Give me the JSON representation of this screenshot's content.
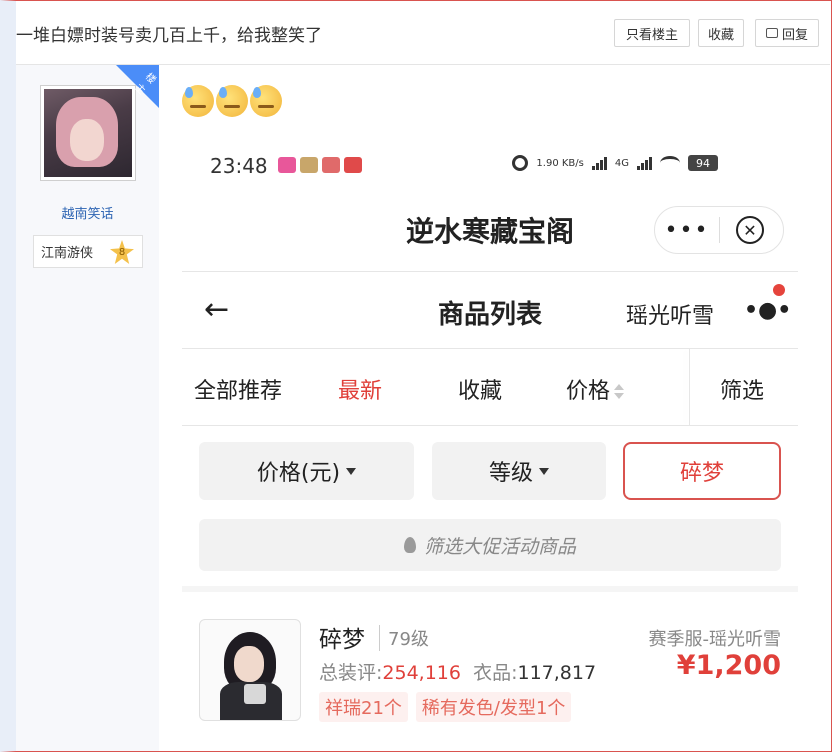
{
  "post": {
    "title": "一堆白嫖时装号卖几百上千，给我整笑了",
    "buttons": {
      "only_op": "只看楼主",
      "favorite": "收藏",
      "reply": "回复"
    }
  },
  "author": {
    "badge": "楼主",
    "name": "越南笑话",
    "rank": "江南游侠",
    "level": "8"
  },
  "screenshot": {
    "status": {
      "time": "23:48",
      "net_speed": "1.90 KB/s",
      "network": "4G",
      "battery": "94"
    },
    "mini_program_title": "逆水寒藏宝阁",
    "capsule": {
      "more": "•••",
      "close": "⊗"
    },
    "nav": {
      "back": "←",
      "title": "商品列表",
      "server": "瑶光听雪",
      "more": "•●•"
    },
    "tabs": [
      {
        "label": "全部推荐"
      },
      {
        "label": "最新"
      },
      {
        "label": "收藏"
      },
      {
        "label": "价格"
      },
      {
        "label": "筛选"
      }
    ],
    "filters": {
      "price": "价格(元)",
      "level": "等级",
      "selected": "碎梦"
    },
    "promo": "筛选大促活动商品",
    "item": {
      "name": "碎梦",
      "level": "79级",
      "server": "赛季服-瑶光听雪",
      "score_label": "总装评:",
      "score": "254,116",
      "clothes_label": "衣品:",
      "clothes": "117,817",
      "price": "¥1,200",
      "tags": [
        "祥瑞21个",
        "稀有发色/发型1个"
      ]
    }
  },
  "colors": {
    "accent_red": "#e0403a",
    "link_blue": "#2d64b3",
    "badge_blue": "#4b8df8"
  }
}
